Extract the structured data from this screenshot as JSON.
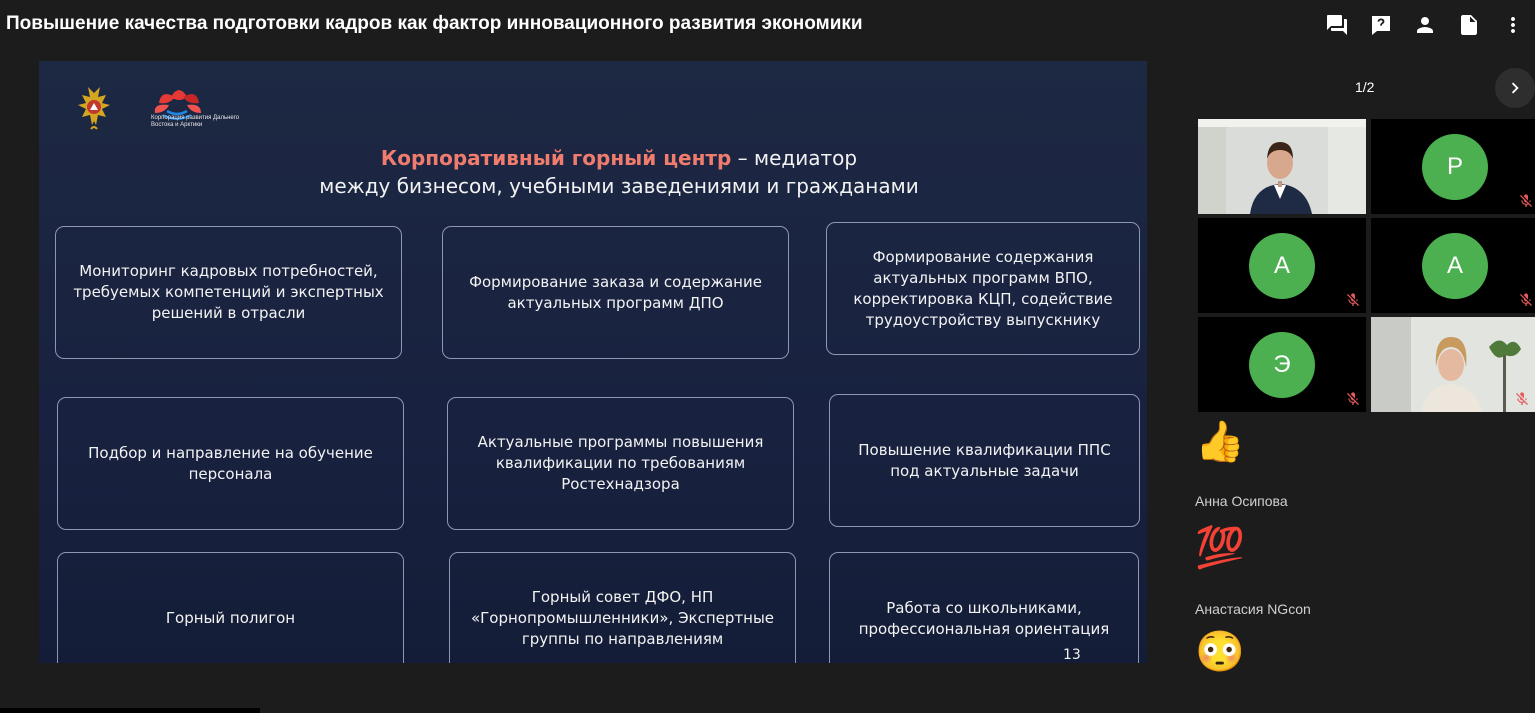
{
  "window": {
    "title": "Повышение качества подготовки кадров как фактор инновационного развития экономики"
  },
  "toolbar": {
    "icons": [
      "chat-icon",
      "help-icon",
      "person-icon",
      "document-icon",
      "more-vert-icon"
    ]
  },
  "slide": {
    "logo_text": "Корпорация развития Дальнего Востока и Арктики",
    "heading_accent": "Корпоративный горный центр",
    "heading_rest": " – медиатор",
    "heading_line2": "между бизнесом, учебными заведениями и гражданами",
    "boxes": [
      "Мониторинг кадровых потребностей, требуемых компетенций и экспертных решений в отрасли",
      "Формирование заказа и содержание актуальных программ ДПО",
      "Формирование содержания актуальных программ ВПО, корректировка КЦП, содействие трудоустройству выпускнику",
      "Подбор и направление на обучение персонала",
      "Актуальные программы повышения квалификации по требованиям Ростехнадзора",
      "Повышение квалификации  ППС под актуальные задачи",
      "Горный полигон",
      "Горный совет ДФО, НП «Горнопромышленники», Экспертные группы по направлениям",
      "Работа со школьниками, профессиональная ориентация"
    ],
    "page_number": "13"
  },
  "participants": {
    "pager": "1/2",
    "tiles": [
      {
        "type": "video",
        "initial": ""
      },
      {
        "type": "avatar",
        "initial": "P"
      },
      {
        "type": "avatar",
        "initial": "A"
      },
      {
        "type": "avatar",
        "initial": "A"
      },
      {
        "type": "avatar",
        "initial": "Э"
      },
      {
        "type": "video",
        "initial": ""
      }
    ],
    "colors": {
      "avatar": "#4caf50",
      "muted": "#e45b5b"
    }
  },
  "reactions": [
    {
      "emoji": "👍",
      "name": ""
    },
    {
      "emoji": "💯",
      "name": "Анна Осипова"
    },
    {
      "emoji": "😳",
      "name": "Анастасия NGcon"
    }
  ]
}
